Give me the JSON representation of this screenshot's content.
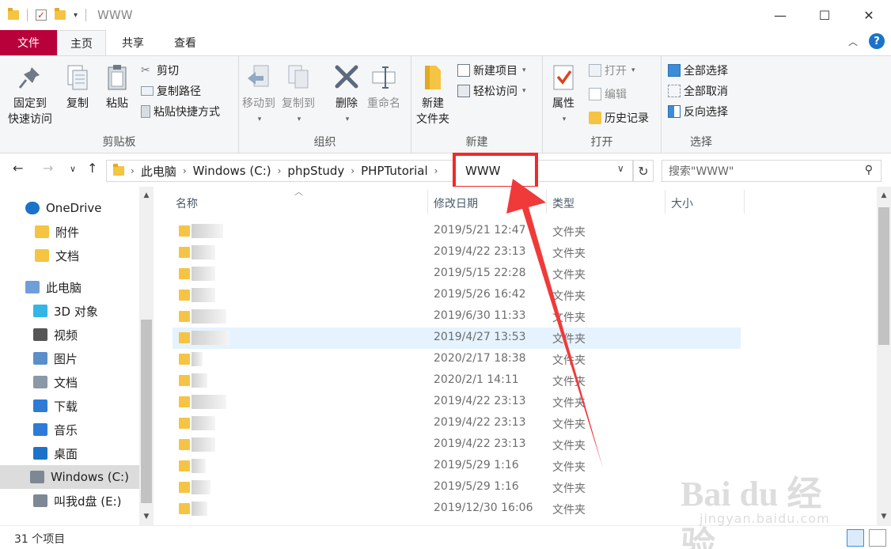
{
  "window": {
    "title": "WWW",
    "controls": {
      "minimize": "—",
      "maximize": "☐",
      "close": "✕"
    }
  },
  "ribbon_tabs": {
    "file": "文件",
    "home": "主页",
    "share": "共享",
    "view": "查看"
  },
  "ribbon": {
    "clipboard": {
      "label": "剪贴板",
      "pin": "固定到",
      "pin2": "快速访问",
      "copy": "复制",
      "paste": "粘贴",
      "cut": "剪切",
      "copy_path": "复制路径",
      "paste_shortcut": "粘贴快捷方式"
    },
    "organize": {
      "label": "组织",
      "move_to": "移动到",
      "copy_to": "复制到",
      "delete": "删除",
      "rename": "重命名"
    },
    "new": {
      "label": "新建",
      "new_folder": "新建",
      "new_folder2": "文件夹",
      "new_item": "新建项目",
      "easy_access": "轻松访问"
    },
    "open": {
      "label": "打开",
      "properties": "属性",
      "open": "打开",
      "edit": "编辑",
      "history": "历史记录"
    },
    "select": {
      "label": "选择",
      "select_all": "全部选择",
      "select_none": "全部取消",
      "invert": "反向选择"
    }
  },
  "address": {
    "crumbs": [
      "此电脑",
      "Windows (C:)",
      "phpStudy",
      "PHPTutorial"
    ],
    "current": "WWW",
    "search_placeholder": "搜索\"WWW\""
  },
  "nav_pane": {
    "items": [
      {
        "label": "OneDrive",
        "icon": "cloud-icon"
      },
      {
        "label": "附件",
        "icon": "folder-icon"
      },
      {
        "label": "文档",
        "icon": "folder-icon"
      },
      {
        "label": "此电脑",
        "icon": "computer-icon"
      },
      {
        "label": "3D 对象",
        "icon": "cube-icon"
      },
      {
        "label": "视频",
        "icon": "video-icon"
      },
      {
        "label": "图片",
        "icon": "picture-icon"
      },
      {
        "label": "文档",
        "icon": "document-icon"
      },
      {
        "label": "下载",
        "icon": "download-icon"
      },
      {
        "label": "音乐",
        "icon": "music-icon"
      },
      {
        "label": "桌面",
        "icon": "desktop-icon"
      },
      {
        "label": "Windows (C:)",
        "icon": "drive-icon"
      },
      {
        "label": "叫我d盘 (E:)",
        "icon": "drive-icon"
      }
    ]
  },
  "file_list": {
    "columns": {
      "name": "名称",
      "date": "修改日期",
      "type": "类型",
      "size": "大小"
    },
    "rows": [
      {
        "date": "2019/5/21 12:47",
        "type": "文件夹"
      },
      {
        "date": "2019/4/22 23:13",
        "type": "文件夹"
      },
      {
        "date": "2019/5/15 22:28",
        "type": "文件夹"
      },
      {
        "date": "2019/5/26 16:42",
        "type": "文件夹"
      },
      {
        "date": "2019/6/30 11:33",
        "type": "文件夹"
      },
      {
        "date": "2019/4/27 13:53",
        "type": "文件夹"
      },
      {
        "date": "2020/2/17 18:38",
        "type": "文件夹"
      },
      {
        "date": "2020/2/1 14:11",
        "type": "文件夹"
      },
      {
        "date": "2019/4/22 23:13",
        "type": "文件夹"
      },
      {
        "date": "2019/4/22 23:13",
        "type": "文件夹"
      },
      {
        "date": "2019/4/22 23:13",
        "type": "文件夹"
      },
      {
        "date": "2019/5/29 1:16",
        "type": "文件夹"
      },
      {
        "date": "2019/5/29 1:16",
        "type": "文件夹"
      },
      {
        "date": "2019/12/30 16:06",
        "type": "文件夹"
      }
    ]
  },
  "status": {
    "count": "31 个项目"
  },
  "watermark": {
    "brand": "Bai du 经验",
    "url": "jingyan.baidu.com"
  },
  "colors": {
    "file_tab": "#b8003a",
    "highlight_box": "#ef2b2b",
    "selected_row": "#e5f3ff",
    "folder": "#f6c445"
  }
}
